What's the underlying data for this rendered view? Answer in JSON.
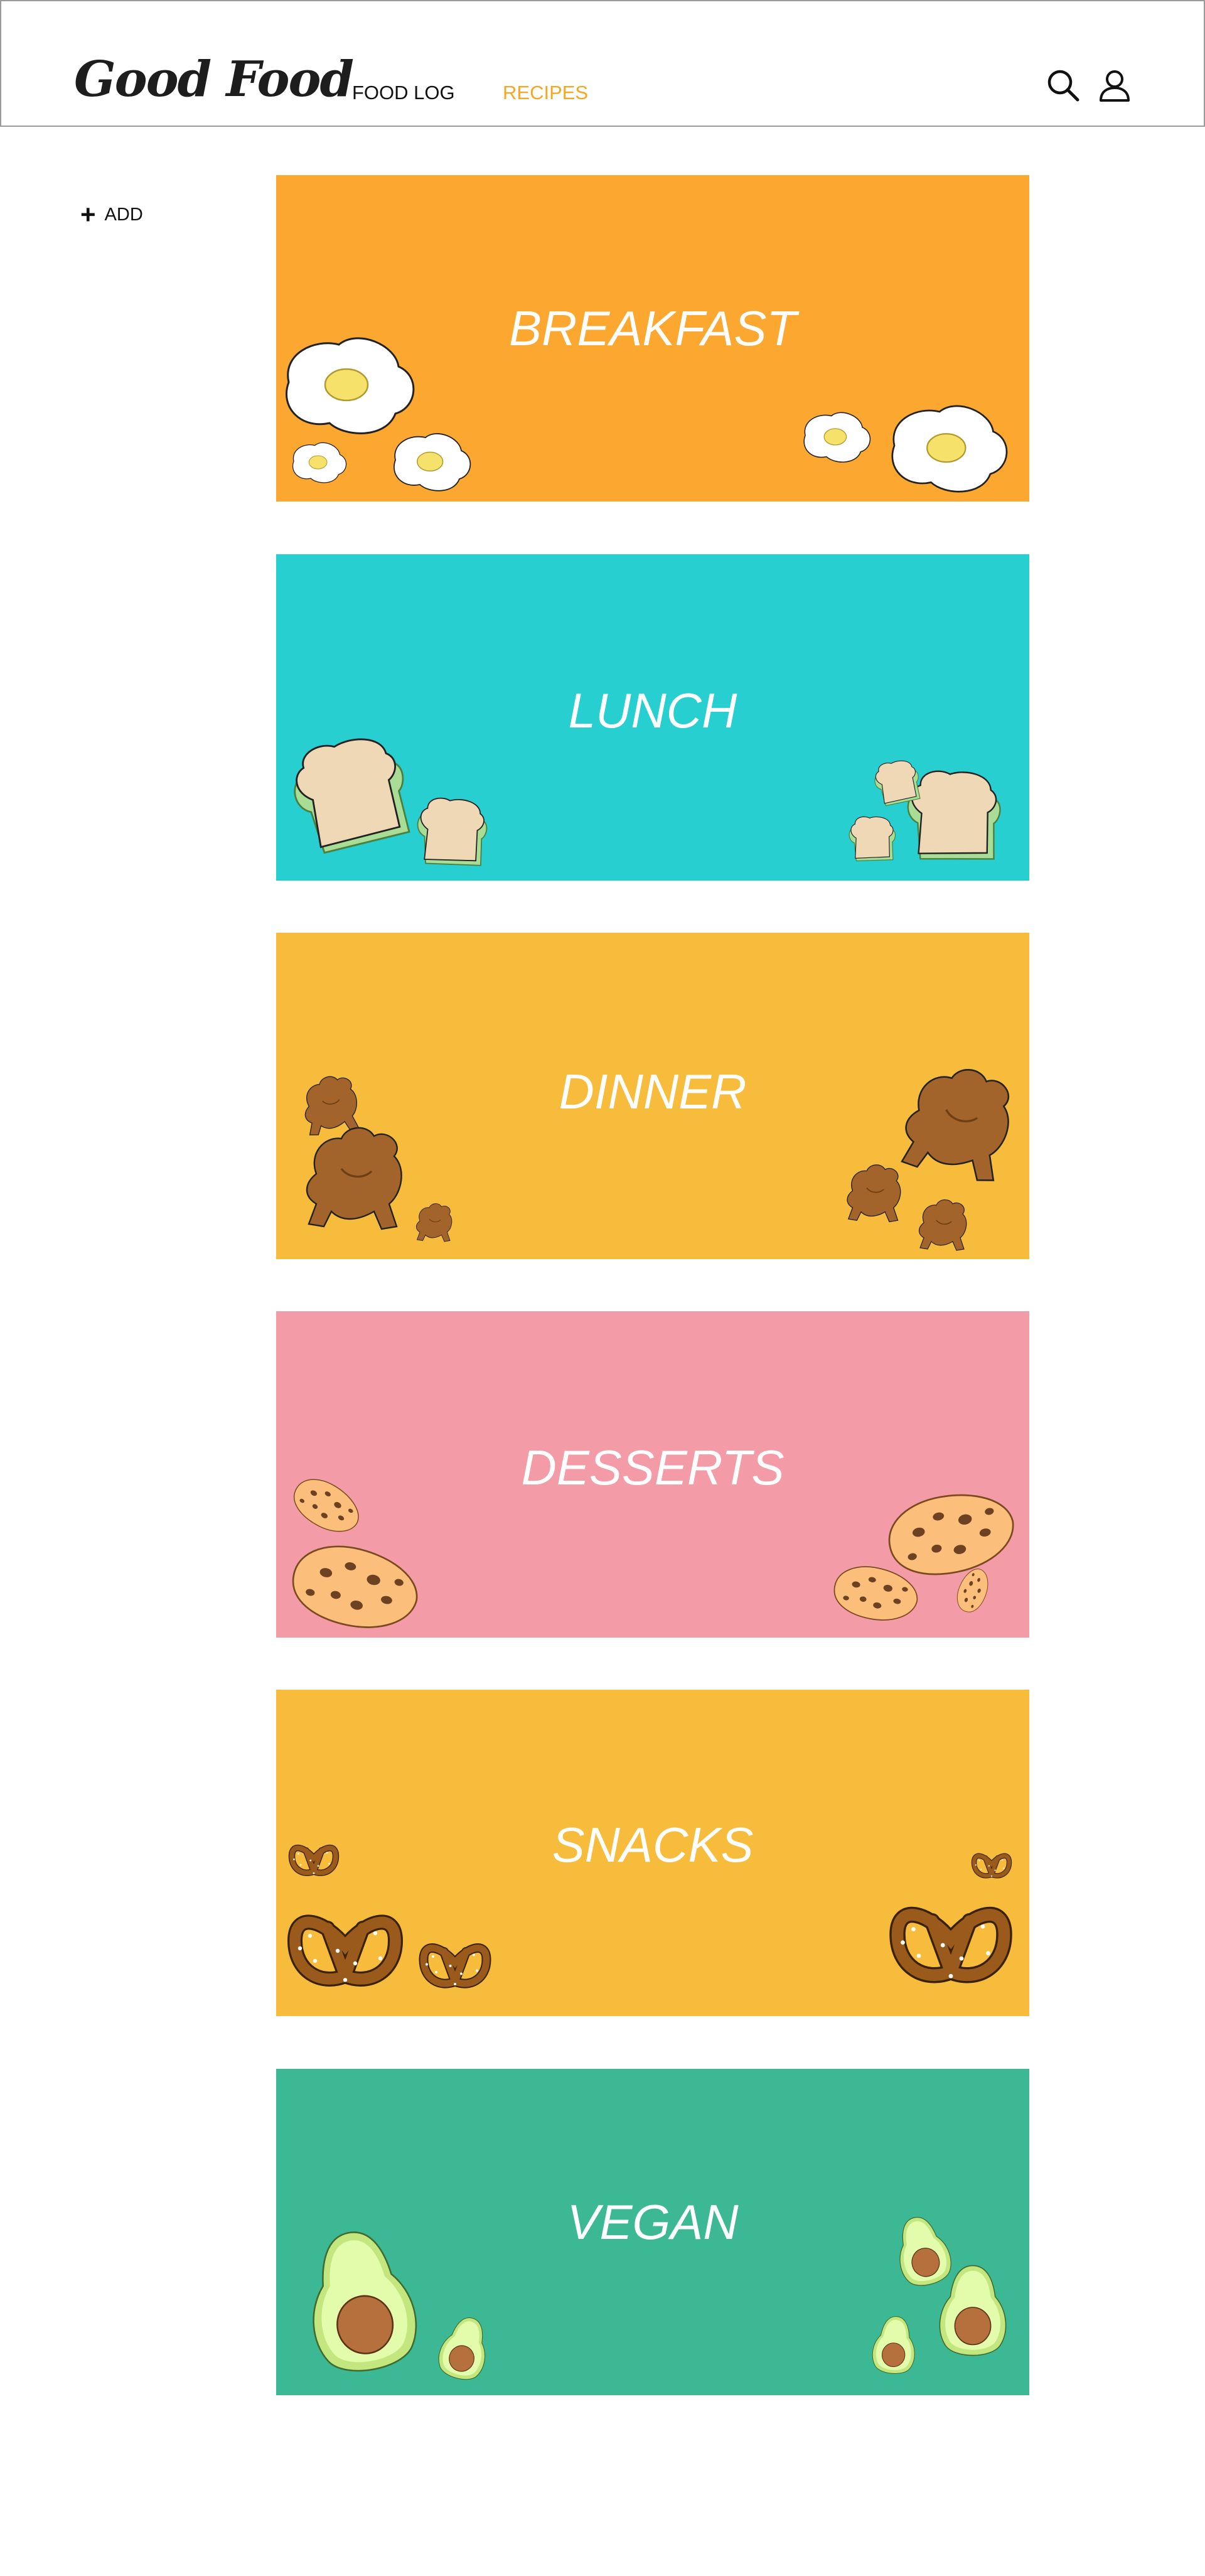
{
  "header": {
    "logo": "Good Food",
    "nav": {
      "food_log": "FOOD LOG",
      "recipes": "RECIPES"
    },
    "active_tab": "RECIPES",
    "accent_color": "#f5a623",
    "icons": {
      "search": "search-icon",
      "account": "user-icon"
    }
  },
  "sidebar": {
    "add_label": "ADD",
    "add_icon": "plus-icon"
  },
  "categories": [
    {
      "title": "BREAKFAST",
      "color": "#fba730",
      "illustration": "fried-egg"
    },
    {
      "title": "LUNCH",
      "color": "#27cfd1",
      "illustration": "sandwich"
    },
    {
      "title": "DINNER",
      "color": "#f8bc3c",
      "illustration": "roast-chicken"
    },
    {
      "title": "DESSERTS",
      "color": "#f39ca7",
      "illustration": "cookie"
    },
    {
      "title": "SNACKS",
      "color": "#f8bc3c",
      "illustration": "pretzel"
    },
    {
      "title": "VEGAN",
      "color": "#3cb994",
      "illustration": "avocado"
    }
  ]
}
